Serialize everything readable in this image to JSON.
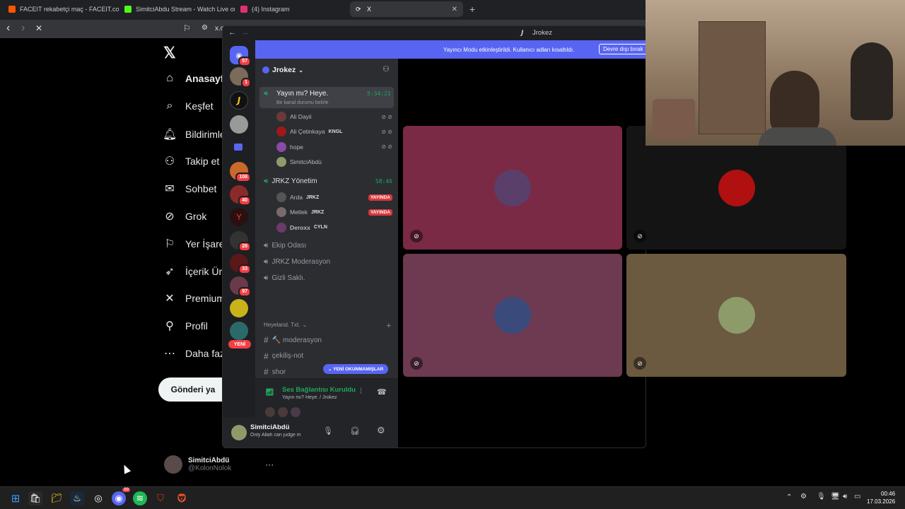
{
  "browser": {
    "tabs": [
      {
        "title": "FACEIT rekabetçi maç - FACEIT.com",
        "color": "#ff5500"
      },
      {
        "title": "SimitciAbdu Stream - Watch Live on",
        "color": "#53fc18"
      },
      {
        "title": "(4) Instagram",
        "color": "#e1306c"
      },
      {
        "title": "X",
        "color": "#ffffff"
      }
    ],
    "new_tab": "+",
    "url": "x.c"
  },
  "x": {
    "logo": "𝕏",
    "nav": [
      {
        "label": "Anasayfa",
        "icon": "home-icon",
        "glyph": "⌂"
      },
      {
        "label": "Keşfet",
        "icon": "search-icon",
        "glyph": "⌕"
      },
      {
        "label": "Bildirimler",
        "icon": "bell-icon",
        "glyph": "🔔︎"
      },
      {
        "label": "Takip et",
        "icon": "follow-icon",
        "glyph": "⚇"
      },
      {
        "label": "Sohbet",
        "icon": "mail-icon",
        "glyph": "✉"
      },
      {
        "label": "Grok",
        "icon": "grok-icon",
        "glyph": "⊘"
      },
      {
        "label": "Yer İşaret",
        "icon": "bookmark-icon",
        "glyph": "⚐"
      },
      {
        "label": "İçerik Üre",
        "icon": "rocket-icon",
        "glyph": "➶"
      },
      {
        "label": "Premium",
        "icon": "x-premium-icon",
        "glyph": "✕"
      },
      {
        "label": "Profil",
        "icon": "profile-icon",
        "glyph": "⚲"
      },
      {
        "label": "Daha faz",
        "icon": "more-icon",
        "glyph": "⋯"
      }
    ],
    "post_button": "Gönderi ya",
    "profile": {
      "name": "SimitciAbdü",
      "handle": "@KolonNolok",
      "more": "···"
    }
  },
  "discord": {
    "window_title": "Jrokez",
    "banner": {
      "text": "Yayıncı Modu etkinleştirildi. Kullanıcı adları kısaltıldı.",
      "button": "Devre dışı bırak"
    },
    "server_name": "Jrokez",
    "rail_badges": [
      "57",
      "1",
      "108",
      "40",
      "28",
      "33",
      "97"
    ],
    "rail_new": "YENİ",
    "voice_channel_1": {
      "name": "Yayın mı? Heye.",
      "timer": "5:34:21",
      "status": "Bir kanal durumu belirle"
    },
    "members_1": [
      {
        "name": "Ali Dayii",
        "tag": ""
      },
      {
        "name": "Ali Çetinkaya",
        "tag": "KNGL"
      },
      {
        "name": "hope",
        "tag": ""
      },
      {
        "name": "SimitciAbdü",
        "tag": ""
      }
    ],
    "voice_channel_2": {
      "name": "JRKZ Yönetim",
      "timer": "58:46"
    },
    "members_2": [
      {
        "name": "Arda",
        "tag": "JRKZ",
        "live": "YAYINDA"
      },
      {
        "name": "Metlek",
        "tag": "JRKZ",
        "live": "YAYINDA"
      },
      {
        "name": "Deroxx",
        "tag": "CYLN",
        "live": ""
      }
    ],
    "voice_channels": [
      "Ekip Odası",
      "JRKZ Moderasyon",
      "Gizli Saklı."
    ],
    "category": "Heyeland. Txt.",
    "text_channels": [
      "🔨 moderasyon",
      "çekiliş-not",
      "shor"
    ],
    "unread_pill": "YENİ OKUNMAMIŞLAR",
    "voice_panel": {
      "status": "Ses Bağlantısı Kuruldu",
      "location": "Yayın mı? Heye. / Jrokez"
    },
    "user": {
      "name": "SimitciAbdü",
      "status": "Only Allah can judge m"
    },
    "tiles": [
      {
        "bg": "#7a2a45",
        "avatar": "#5a3f6a"
      },
      {
        "bg": "#141414",
        "avatar": "#b01010"
      },
      {
        "bg": "#6d3a52",
        "avatar": "#3a4a7a"
      },
      {
        "bg": "#6b5a3f",
        "avatar": "#8d9b6a"
      }
    ]
  },
  "taskbar": {
    "time": "00:46",
    "date": "17.03.2026",
    "badge": "99"
  }
}
